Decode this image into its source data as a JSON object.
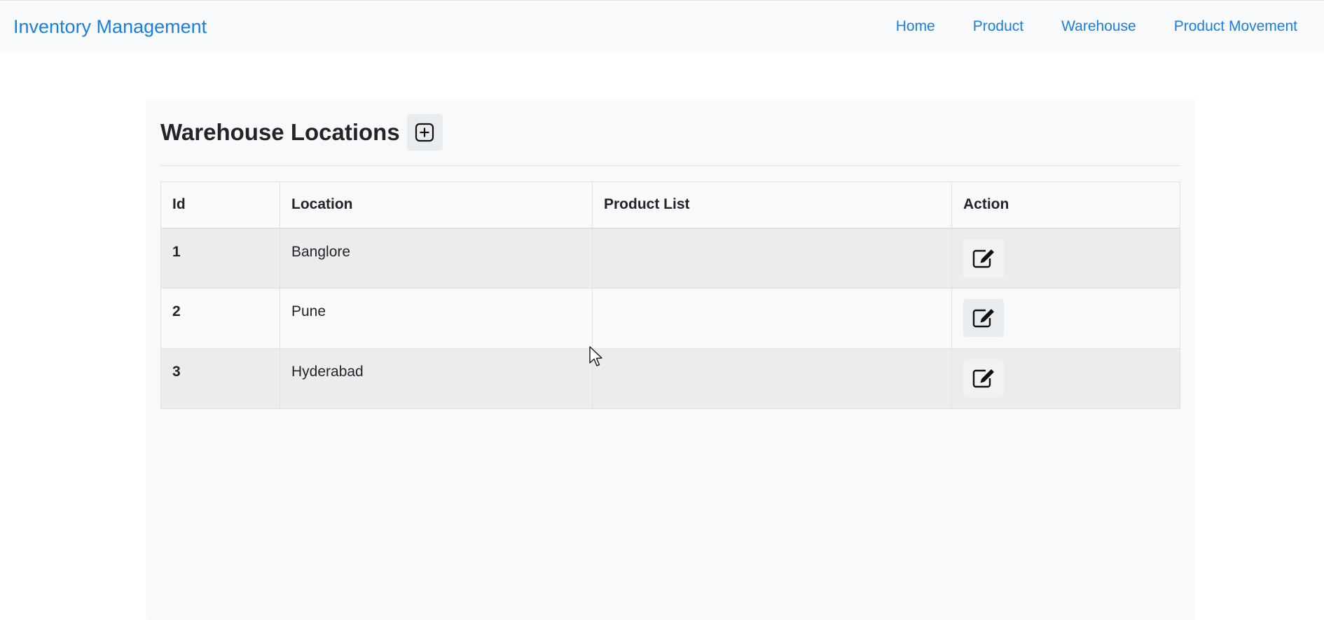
{
  "navbar": {
    "brand": "Inventory Management",
    "links": [
      "Home",
      "Product",
      "Warehouse",
      "Product Movement"
    ]
  },
  "page": {
    "title": "Warehouse Locations",
    "add_icon": "plus-square-icon"
  },
  "table": {
    "headers": [
      "Id",
      "Location",
      "Product List",
      "Action"
    ],
    "rows": [
      {
        "id": "1",
        "location": "Banglore",
        "product_list": "",
        "action_icon": "edit-icon"
      },
      {
        "id": "2",
        "location": "Pune",
        "product_list": "",
        "action_icon": "edit-icon"
      },
      {
        "id": "3",
        "location": "Hyderabad",
        "product_list": "",
        "action_icon": "edit-icon"
      }
    ]
  },
  "colors": {
    "link": "#1a7fe0",
    "navbar_bg": "#f8f9fa",
    "stripe": "#ebecee"
  }
}
